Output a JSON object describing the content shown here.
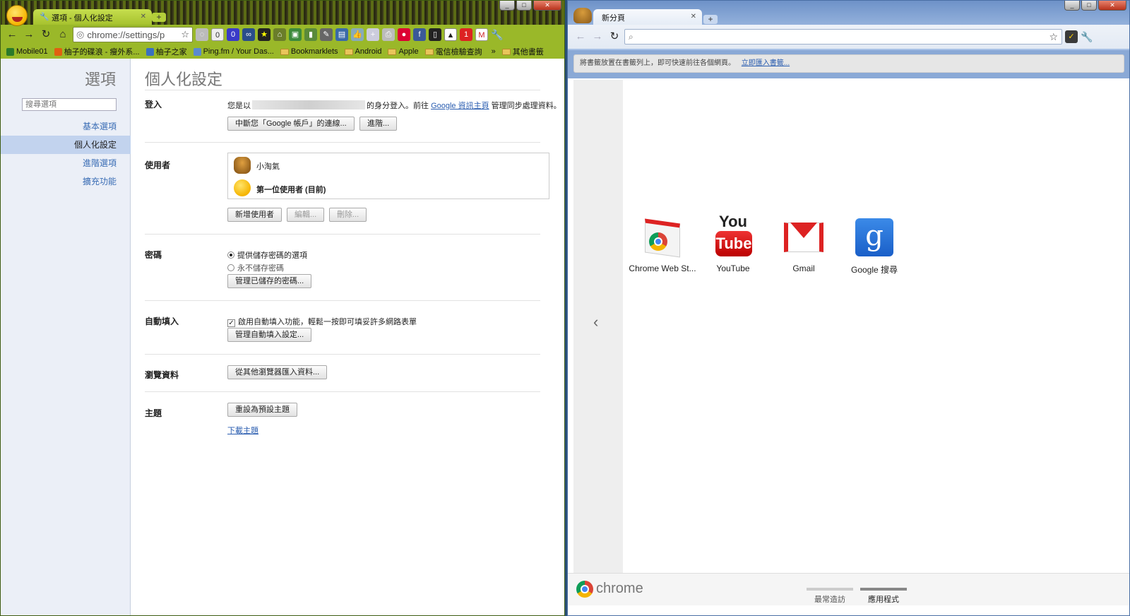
{
  "left": {
    "tab_title": "選項 - 個人化設定",
    "url": "chrome://settings/p",
    "bookmarks": [
      "Mobile01",
      "柚子的碟浪 - 瘦外系...",
      "柚子之家",
      "Ping.fm / Your Das...",
      "Bookmarklets",
      "Android",
      "Apple",
      "電信檢驗查詢",
      "其他書籤"
    ],
    "bookmarks_more": "»",
    "ext_badge": "0",
    "ext_badge2": "1",
    "sidebar": {
      "title": "選項",
      "search_placeholder": "搜尋選項",
      "items": [
        "基本選項",
        "個人化設定",
        "進階選項",
        "擴充功能"
      ]
    },
    "main": {
      "title": "個人化設定",
      "signin": {
        "label": "登入",
        "text_pre": "您是以",
        "text_mid": "的身分登入。前往",
        "link": "Google 資訊主頁",
        "text_post": "管理同步處理資料。",
        "btn_disconnect": "中斷您「Google 帳戶」的連線...",
        "btn_advanced": "進階..."
      },
      "users": {
        "label": "使用者",
        "list": [
          "小淘氣",
          "第一位使用者 (目前)"
        ],
        "btn_add": "新增使用者",
        "btn_edit": "編輯...",
        "btn_delete": "刪除..."
      },
      "passwords": {
        "label": "密碼",
        "opt_offer": "提供儲存密碼的選項",
        "opt_never": "永不儲存密碼",
        "btn_manage": "管理已儲存的密碼..."
      },
      "autofill": {
        "label": "自動填入",
        "check": "啟用自動填入功能，輕鬆一按即可填妥許多網路表單",
        "btn_manage": "管理自動填入設定..."
      },
      "browsing": {
        "label": "瀏覽資料",
        "btn_import": "從其他瀏覽器匯入資料..."
      },
      "themes": {
        "label": "主題",
        "btn_reset": "重設為預設主題",
        "link_get": "下載主題"
      }
    }
  },
  "right": {
    "tab_title": "新分頁",
    "bookmark_bar_text": "將書籤放置在書籤列上，即可快速前往各個網頁。",
    "bookmark_bar_link": "立即匯入書籤...",
    "apps": [
      "Chrome Web St...",
      "YouTube",
      "Gmail",
      "Google 搜尋"
    ],
    "youtube_you": "You",
    "youtube_tube": "Tube",
    "prev_arrow": "‹",
    "chrome_logo_text": "chrome",
    "footer_tabs": [
      "最常造訪",
      "應用程式"
    ]
  },
  "colors": {
    "left_frame": "#9ab829",
    "right_frame": "#9cb8e0",
    "link": "#2a5db0",
    "sidebar_selected": "#c2d3ee"
  },
  "icons": [
    "back-icon",
    "forward-icon",
    "reload-icon",
    "home-icon",
    "star-icon",
    "wrench-icon",
    "search-icon",
    "close-icon",
    "new-tab-icon"
  ]
}
